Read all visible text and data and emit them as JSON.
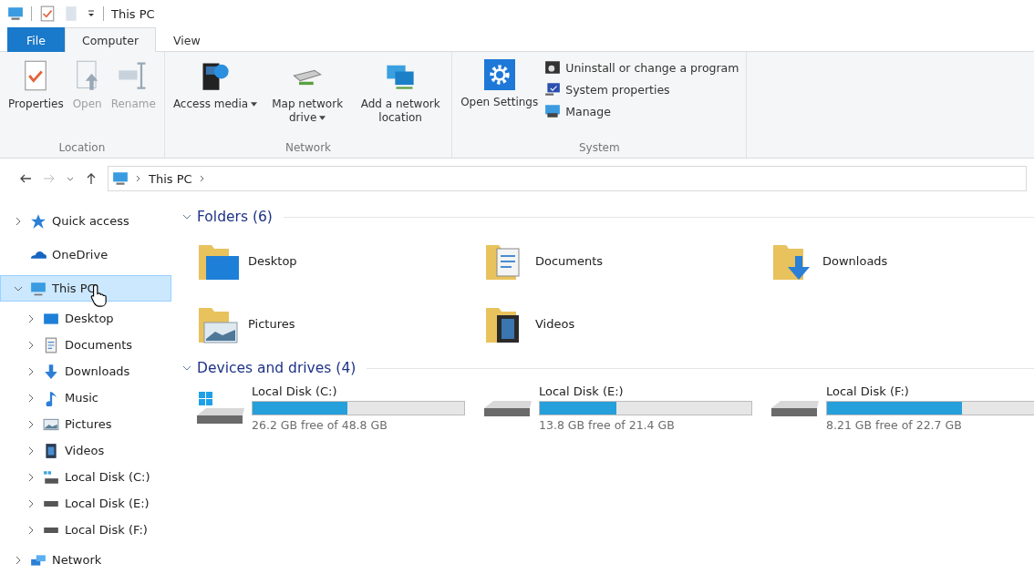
{
  "window": {
    "title": "This PC"
  },
  "ribbon_tabs": [
    {
      "label": "File",
      "kind": "file",
      "selected": false
    },
    {
      "label": "Computer",
      "kind": "tab",
      "selected": true
    },
    {
      "label": "View",
      "kind": "tab",
      "selected": false
    }
  ],
  "ribbon_groups": [
    {
      "label": "Location",
      "commands": [
        {
          "label": "Properties",
          "kind": "properties",
          "disabled": false,
          "dropdown": false
        },
        {
          "label": "Open",
          "kind": "open",
          "disabled": true,
          "dropdown": false
        },
        {
          "label": "Rename",
          "kind": "rename",
          "disabled": true,
          "dropdown": false
        }
      ]
    },
    {
      "label": "Network",
      "commands": [
        {
          "label": "Access media",
          "kind": "media",
          "disabled": false,
          "dropdown": true
        },
        {
          "label": "Map network drive",
          "kind": "netdrive",
          "disabled": false,
          "dropdown": true
        },
        {
          "label": "Add a network location",
          "kind": "netloc",
          "disabled": false,
          "dropdown": false
        }
      ]
    },
    {
      "label": "System",
      "commands": [
        {
          "label": "Open Settings",
          "kind": "settings",
          "disabled": false,
          "dropdown": false
        }
      ],
      "small_commands": [
        {
          "label": "Uninstall or change a program",
          "kind": "uninstall"
        },
        {
          "label": "System properties",
          "kind": "sysprops"
        },
        {
          "label": "Manage",
          "kind": "manage"
        }
      ]
    }
  ],
  "address_bar": {
    "path": [
      "This PC"
    ]
  },
  "navigation": [
    {
      "label": "Quick access",
      "kind": "star",
      "expandable": true,
      "expanded": false,
      "selected": false
    },
    {
      "label": "OneDrive",
      "kind": "cloud",
      "expandable": false,
      "selected": false
    },
    {
      "label": "This PC",
      "kind": "pc",
      "expandable": true,
      "expanded": true,
      "selected": true,
      "children": [
        {
          "label": "Desktop",
          "kind": "desktop",
          "expandable": true,
          "expanded": false,
          "selected": false
        },
        {
          "label": "Documents",
          "kind": "documents",
          "expandable": true,
          "expanded": false,
          "selected": false
        },
        {
          "label": "Downloads",
          "kind": "downloads",
          "expandable": true,
          "expanded": false,
          "selected": false
        },
        {
          "label": "Music",
          "kind": "music",
          "expandable": true,
          "expanded": false,
          "selected": false
        },
        {
          "label": "Pictures",
          "kind": "pictures",
          "expandable": true,
          "expanded": false,
          "selected": false
        },
        {
          "label": "Videos",
          "kind": "videos",
          "expandable": true,
          "expanded": false,
          "selected": false
        },
        {
          "label": "Local Disk (C:)",
          "kind": "windrive",
          "expandable": true,
          "expanded": false,
          "selected": false
        },
        {
          "label": "Local Disk (E:)",
          "kind": "drive",
          "expandable": true,
          "expanded": false,
          "selected": false
        },
        {
          "label": "Local Disk (F:)",
          "kind": "drive",
          "expandable": true,
          "expanded": false,
          "selected": false
        }
      ]
    },
    {
      "label": "Network",
      "kind": "network",
      "expandable": true,
      "expanded": false,
      "selected": false
    }
  ],
  "folders_section": {
    "title": "Folders (6)",
    "expanded": true,
    "items": [
      {
        "label": "Desktop",
        "kind": "desktop"
      },
      {
        "label": "Documents",
        "kind": "documents"
      },
      {
        "label": "Downloads",
        "kind": "downloads"
      },
      {
        "label": "Pictures",
        "kind": "pictures"
      },
      {
        "label": "Videos",
        "kind": "videos"
      }
    ]
  },
  "drives_section": {
    "title": "Devices and drives (4)",
    "expanded": true,
    "items": [
      {
        "label": "Local Disk (C:)",
        "kind": "windrive",
        "level": 0.45,
        "free": "26.2 GB free of 48.8 GB"
      },
      {
        "label": "Local Disk (E:)",
        "kind": "drive",
        "level": 0.36,
        "free": "13.8 GB free of 21.4 GB"
      },
      {
        "label": "Local Disk (F:)",
        "kind": "drive",
        "level": 0.64,
        "free": "8.21 GB free of 22.7 GB"
      }
    ]
  }
}
